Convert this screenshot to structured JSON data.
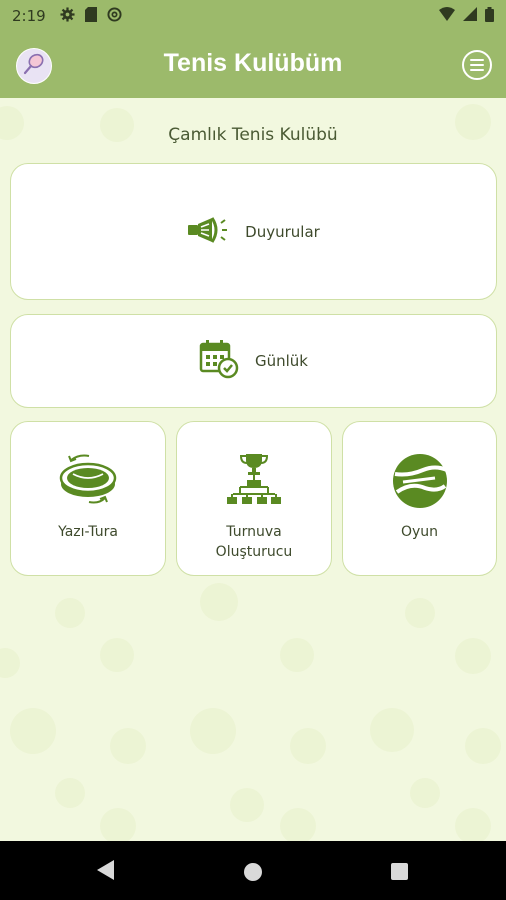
{
  "status_bar": {
    "time": "2:19",
    "left_icons": [
      "gear-icon",
      "sd-card-icon",
      "at-sign-icon"
    ],
    "right_icons": [
      "wifi-icon",
      "cellular-signal-icon",
      "battery-icon"
    ]
  },
  "app_bar": {
    "title": "Tenis Kulübüm",
    "avatar_icon": "tennis-racket-icon",
    "menu_icon": "hamburger-menu-icon"
  },
  "club_name": "Çamlık Tenis Kulübü",
  "cards": {
    "announcements": {
      "label": "Duyurular",
      "icon": "megaphone-icon"
    },
    "daily": {
      "label": "Günlük",
      "icon": "calendar-check-icon"
    },
    "coin_toss": {
      "label": "Yazı-Tura",
      "icon": "coin-flip-icon"
    },
    "tournament": {
      "label_line1": "Turnuva",
      "label_line2": "Oluşturucu",
      "icon": "tournament-bracket-icon"
    },
    "game": {
      "label": "Oyun",
      "icon": "tennis-ball-icon"
    }
  },
  "nav_bar": {
    "back_icon": "back-triangle-icon",
    "home_icon": "home-circle-icon",
    "recents_icon": "recents-square-icon"
  },
  "colors": {
    "accent": "#9cba6b",
    "icon_green": "#5a8a22",
    "background": "#f2f8df",
    "card_border": "#cfe0a6"
  }
}
